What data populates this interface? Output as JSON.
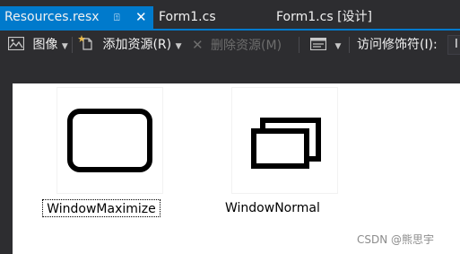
{
  "tabs": [
    {
      "label": "Resources.resx",
      "active": true,
      "pin_glyph": "⍐",
      "close_glyph": "✕"
    },
    {
      "label": "Form1.cs",
      "active": false
    },
    {
      "label": "Form1.cs [设计]",
      "active": false
    }
  ],
  "toolbar": {
    "resource_type_label": "图像",
    "add_resource_label": "添加资源(R)",
    "delete_resource_label": "删除资源(M)",
    "access_modifier_label": "访问修饰符(I):",
    "access_modifier_value": "I"
  },
  "resources": [
    {
      "name": "WindowMaximize",
      "icon": "window-maximize-icon",
      "selected": true
    },
    {
      "name": "WindowNormal",
      "icon": "window-restore-icon",
      "selected": false
    }
  ],
  "watermark": "CSDN @熊思宇",
  "colors": {
    "accent": "#007acc",
    "background": "#2d2d30",
    "canvas": "#ffffff"
  }
}
